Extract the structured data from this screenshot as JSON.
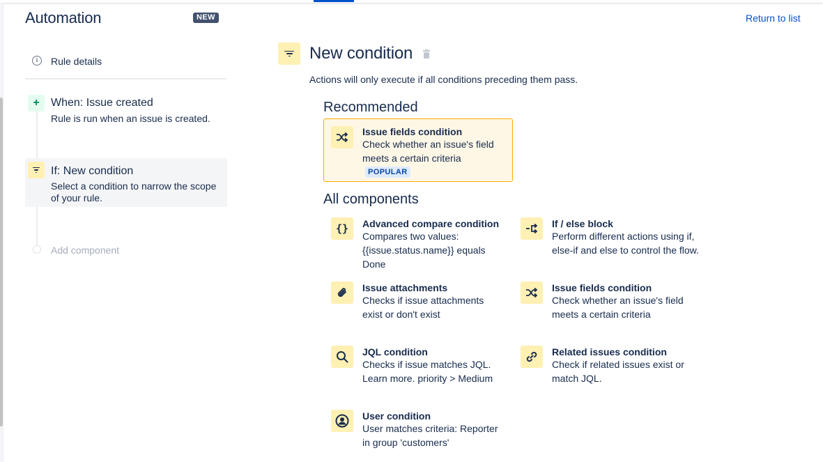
{
  "app": {
    "title": "Automation",
    "badge": "NEW",
    "return_link": "Return to list"
  },
  "sidebar": {
    "rule_details": "Rule details",
    "steps": [
      {
        "title": "When: Issue created",
        "desc": "Rule is run when an issue is created.",
        "icon": "plus-icon"
      },
      {
        "title": "If: New condition",
        "desc": "Select a condition to narrow the scope of your rule.",
        "icon": "filter-icon"
      }
    ],
    "add_component": "Add component"
  },
  "main": {
    "title": "New condition",
    "subtitle": "Actions will only execute if all conditions preceding them pass.",
    "recommended_heading": "Recommended",
    "all_heading": "All components",
    "recommended": {
      "title": "Issue fields condition",
      "desc": "Check whether an issue's field meets a certain criteria",
      "badge": "POPULAR",
      "icon": "shuffle-icon"
    },
    "components": [
      {
        "title": "Advanced compare condition",
        "desc": "Compares two values: {{issue.status.name}} equals Done",
        "icon": "braces-icon"
      },
      {
        "title": "If / else block",
        "desc": "Perform different actions using if, else-if and else to control the flow.",
        "icon": "branch-icon"
      },
      {
        "title": "Issue attachments",
        "desc": "Checks if issue attachments exist or don't exist",
        "icon": "paperclip-icon"
      },
      {
        "title": "Issue fields condition",
        "desc": "Check whether an issue's field meets a certain criteria",
        "icon": "shuffle-icon"
      },
      {
        "title": "JQL condition",
        "desc": "Checks if issue matches JQL. Learn more. priority > Medium",
        "icon": "search-icon"
      },
      {
        "title": "Related issues condition",
        "desc": "Check if related issues exist or match JQL.",
        "icon": "link-icon"
      },
      {
        "title": "User condition",
        "desc": "User matches criteria: Reporter in group 'customers'",
        "icon": "user-icon"
      }
    ]
  },
  "colors": {
    "accent": "#0052CC",
    "text": "#172B4D",
    "condition_bg": "#FFF0B3",
    "trigger_bg": "#E3FCEF",
    "recommended_border": "#FFAB00"
  }
}
